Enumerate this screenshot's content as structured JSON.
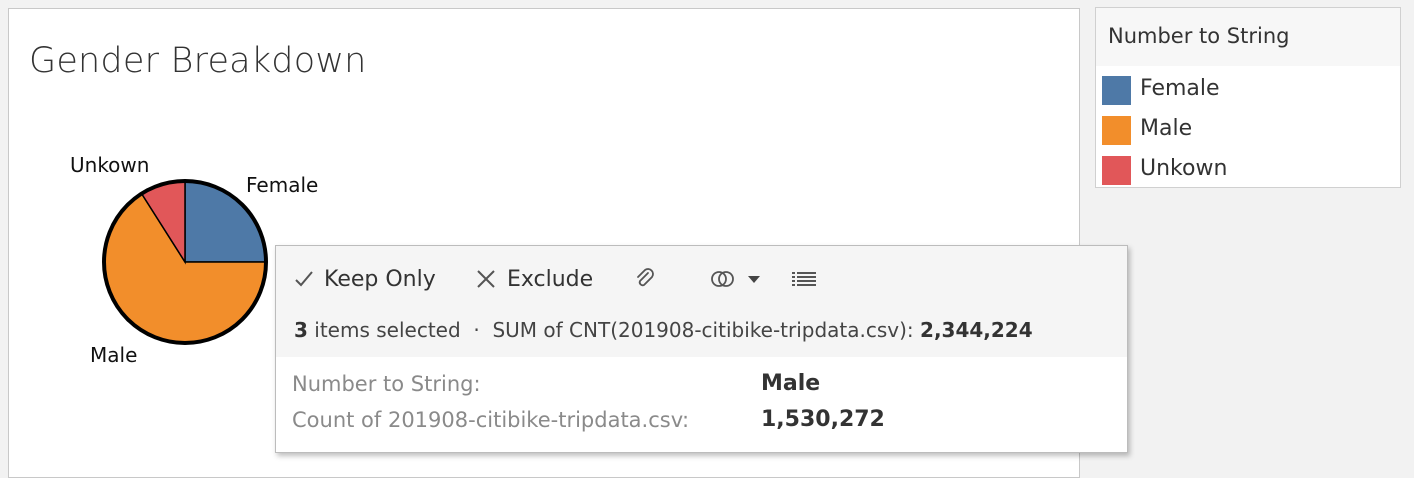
{
  "worksheet": {
    "title": "Gender Breakdown"
  },
  "chart_data": {
    "type": "pie",
    "title": "Gender Breakdown",
    "categories": [
      "Female",
      "Male",
      "Unkown"
    ],
    "values": [
      0.25,
      0.66,
      0.09
    ],
    "colors": [
      "#4e79a7",
      "#f28e2b",
      "#e15759"
    ],
    "selected_category": "Male"
  },
  "legend": {
    "title": "Number to String",
    "items": [
      {
        "label": "Female",
        "color": "#4e79a7"
      },
      {
        "label": "Male",
        "color": "#f28e2b"
      },
      {
        "label": "Unkown",
        "color": "#e15759"
      }
    ]
  },
  "tooltip": {
    "actions": {
      "keep_only": "Keep Only",
      "exclude": "Exclude"
    },
    "summary": {
      "count": "3",
      "items_text": "items selected",
      "separator": "·",
      "measure": "SUM of CNT(201908-citibike-tripdata.csv):",
      "total": "2,344,224"
    },
    "details": [
      {
        "key": "Number to String:",
        "value": "Male"
      },
      {
        "key": "Count of 201908-citibike-tripdata.csv:",
        "value": "1,530,272"
      }
    ]
  }
}
